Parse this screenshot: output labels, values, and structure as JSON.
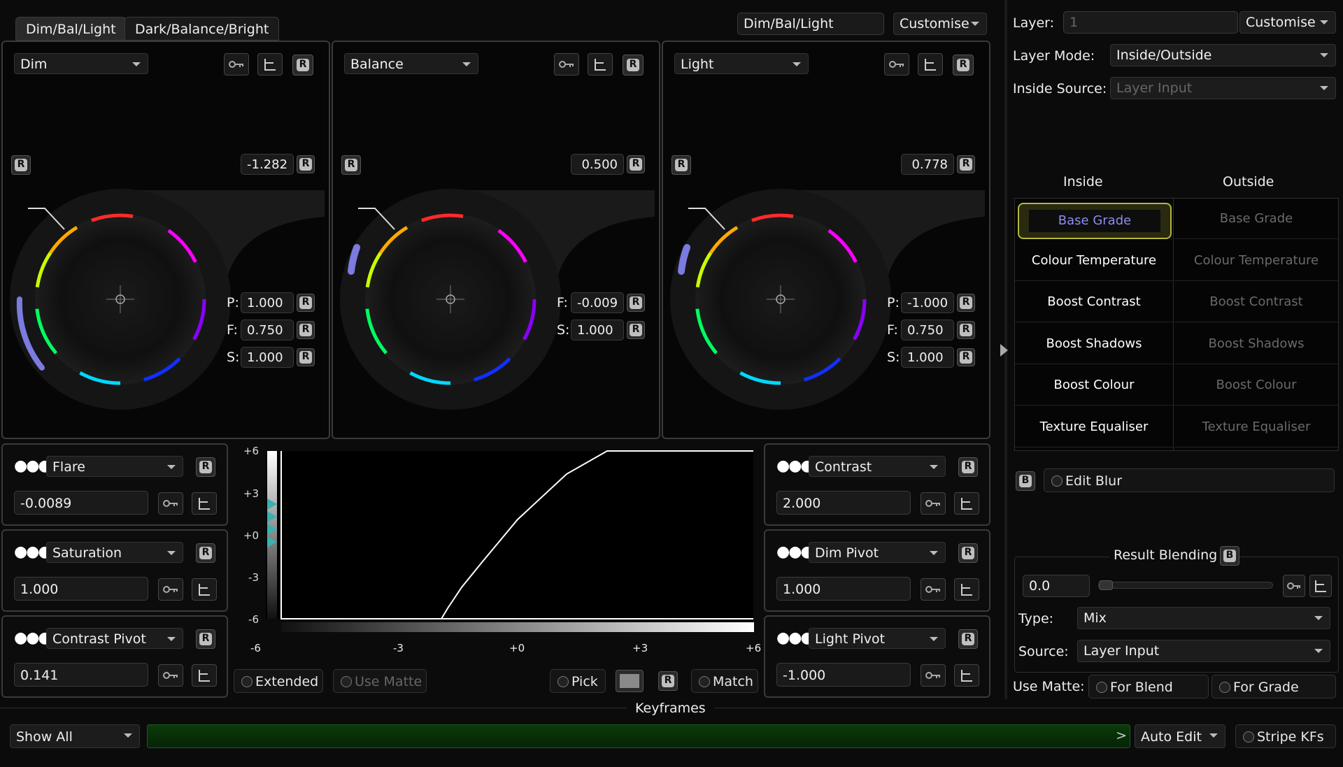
{
  "tabs": [
    "Dim/Bal/Light",
    "Dark/Balance/Bright"
  ],
  "preset": {
    "name": "Dim/Bal/Light",
    "customise": "Customise"
  },
  "wheels": [
    {
      "mode": "Dim",
      "value": "-1.282",
      "params": [
        {
          "k": "P:",
          "v": "1.000"
        },
        {
          "k": "F:",
          "v": "0.750"
        },
        {
          "k": "S:",
          "v": "1.000"
        }
      ]
    },
    {
      "mode": "Balance",
      "value": "0.500",
      "params": [
        {
          "k": "F:",
          "v": "-0.009"
        },
        {
          "k": "S:",
          "v": "1.000"
        }
      ]
    },
    {
      "mode": "Light",
      "value": "0.778",
      "params": [
        {
          "k": "P:",
          "v": "-1.000"
        },
        {
          "k": "F:",
          "v": "0.750"
        },
        {
          "k": "S:",
          "v": "1.000"
        }
      ]
    }
  ],
  "reset_glyph": "R",
  "left_controls": [
    {
      "name": "Flare",
      "value": "-0.0089"
    },
    {
      "name": "Saturation",
      "value": "1.000"
    },
    {
      "name": "Contrast Pivot",
      "value": "0.141"
    }
  ],
  "right_controls": [
    {
      "name": "Contrast",
      "value": "2.000"
    },
    {
      "name": "Dim Pivot",
      "value": "1.000"
    },
    {
      "name": "Light Pivot",
      "value": "-1.000"
    }
  ],
  "dots": "●●●",
  "graph": {
    "y_ticks": [
      "+6",
      "+3",
      "+0",
      "-3",
      "-6"
    ],
    "x_ticks": [
      "-6",
      "-3",
      "+0",
      "+3",
      "+6"
    ]
  },
  "bottom_buttons": {
    "extended": "Extended",
    "use_matte": "Use Matte",
    "pick": "Pick",
    "match": "Match"
  },
  "right_panel": {
    "layer_label": "Layer:",
    "layer_value": "1",
    "customise": "Customise",
    "layer_mode_label": "Layer Mode:",
    "layer_mode_value": "Inside/Outside",
    "inside_source_label": "Inside Source:",
    "inside_source_value": "Layer Input",
    "inside_header": "Inside",
    "outside_header": "Outside",
    "grades": [
      "Base Grade",
      "Colour Temperature",
      "Boost Contrast",
      "Boost Shadows",
      "Boost Colour",
      "Texture Equaliser"
    ],
    "blur_btn": "B",
    "edit_blur": "Edit Blur",
    "result_blending": "Result Blending",
    "rb_btn": "B",
    "blend_value": "0.0",
    "type_label": "Type:",
    "type_value": "Mix",
    "source_label": "Source:",
    "source_value": "Layer Input",
    "use_matte_label": "Use Matte:",
    "for_blend": "For Blend",
    "for_grade": "For Grade"
  },
  "keyframes": {
    "title": "Keyframes",
    "show": "Show All",
    "auto_edit": "Auto Edit",
    "stripe": "Stripe KFs",
    "arrow": ">"
  },
  "colors": {
    "accent": "#7b7be0",
    "highlight": "#b6b83a"
  }
}
